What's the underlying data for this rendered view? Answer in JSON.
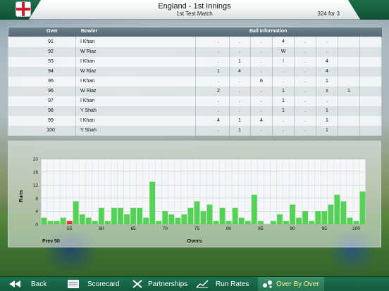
{
  "header": {
    "title": "England - 1st Innings",
    "subtitle": "1st Test Match",
    "score": "324 for 3"
  },
  "table": {
    "headers": {
      "over": "Over",
      "bowler": "Bowler",
      "ball_info": "Ball Information"
    },
    "rows": [
      {
        "over": "91",
        "bowler": "I Khan",
        "balls": [
          ".",
          ".",
          ".",
          "4",
          ".",
          ".",
          "",
          "",
          ""
        ]
      },
      {
        "over": "92",
        "bowler": "W Riaz",
        "balls": [
          ".",
          ".",
          ".",
          "W",
          ".",
          ".",
          "",
          "",
          ""
        ]
      },
      {
        "over": "93",
        "bowler": "I Khan",
        "balls": [
          ".",
          "1",
          ".",
          "!",
          ".",
          "4",
          "",
          "",
          ""
        ]
      },
      {
        "over": "94",
        "bowler": "W Riaz",
        "balls": [
          "1",
          "4",
          ".",
          ".",
          ".",
          "4",
          "",
          "",
          ""
        ]
      },
      {
        "over": "95",
        "bowler": "I Khan",
        "balls": [
          ".",
          ".",
          "6",
          ".",
          ".",
          "1",
          "",
          "",
          ""
        ]
      },
      {
        "over": "96",
        "bowler": "W Riaz",
        "balls": [
          "2",
          ".",
          ".",
          "1",
          ".",
          "x",
          "1",
          "",
          ""
        ]
      },
      {
        "over": "97",
        "bowler": "I Khan",
        "balls": [
          ".",
          ".",
          ".",
          "1",
          ".",
          ".",
          "",
          "",
          ""
        ]
      },
      {
        "over": "98",
        "bowler": "Y Shah",
        "balls": [
          ".",
          ".",
          ".",
          "1",
          ".",
          "1",
          "",
          "",
          ""
        ]
      },
      {
        "over": "99",
        "bowler": "I Khan",
        "balls": [
          "4",
          "1",
          "4",
          ".",
          ".",
          "1",
          "",
          "",
          ""
        ]
      },
      {
        "over": "100",
        "bowler": "Y Shah",
        "balls": [
          ".",
          "1",
          ".",
          ".",
          ".",
          "1",
          "",
          "",
          ""
        ]
      }
    ]
  },
  "chart_data": {
    "type": "bar",
    "xlabel": "Overs",
    "ylabel": "Runs",
    "ylim": [
      0,
      20
    ],
    "yticks": [
      0,
      4,
      8,
      12,
      16,
      20
    ],
    "xticks": [
      55,
      60,
      65,
      70,
      75,
      80,
      85,
      90,
      95,
      100
    ],
    "x_start": 51,
    "values": [
      2,
      1,
      1,
      2,
      1,
      7,
      3,
      2,
      1,
      5,
      1,
      5,
      5,
      3,
      5,
      5,
      2,
      13,
      1,
      4,
      3,
      2,
      3,
      5,
      7,
      4,
      6,
      1,
      5,
      1,
      5,
      2,
      1,
      9,
      1,
      0,
      1,
      3,
      1,
      6,
      2,
      4,
      1,
      4,
      4,
      6,
      9,
      7,
      2,
      1,
      10
    ],
    "colors": [
      "green",
      "green",
      "green",
      "green",
      "red",
      "green",
      "green",
      "green",
      "green",
      "green",
      "green",
      "green",
      "green",
      "green",
      "green",
      "green",
      "green",
      "green",
      "green",
      "green",
      "green",
      "green",
      "green",
      "green",
      "green",
      "green",
      "green",
      "green",
      "green",
      "green",
      "green",
      "green",
      "green",
      "green",
      "green",
      "green",
      "green",
      "green",
      "green",
      "green",
      "green",
      "green",
      "green",
      "green",
      "green",
      "green",
      "green",
      "green",
      "green",
      "green",
      "green"
    ],
    "bottom_left_label": "Prev 50",
    "bar_color": "#55d255",
    "wicket_color": "#e53030",
    "grid": true
  },
  "footer": {
    "back": "Back",
    "scorecard": "Scorecard",
    "partnerships": "Partnerships",
    "run_rates": "Run Rates",
    "over_by_over": "Over By Over"
  },
  "colors": {
    "header_green": "#145c3e",
    "active_text": "#f7f07a"
  }
}
